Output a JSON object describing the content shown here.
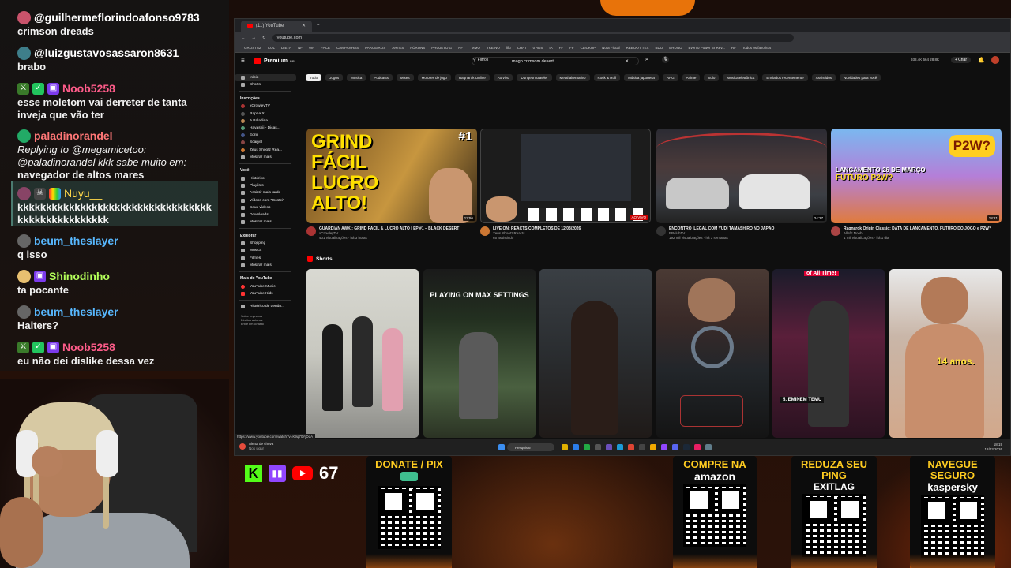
{
  "chat": {
    "messages": [
      {
        "user": "@guilhermeflorindoafonso9783",
        "text": "crimson dreads",
        "color": "#ffffff",
        "avatar_color": "#c9536b",
        "badges": []
      },
      {
        "user": "@luizgustavosassaron8631",
        "text": "brabo",
        "color": "#ffffff",
        "avatar_color": "#3e7e8a",
        "badges": []
      },
      {
        "user": "Noob5258",
        "text": "esse moletom vai derreter de tanta inveja que vão ter",
        "color": "#ff5c8a",
        "avatar_color": "#6c3",
        "badges": [
          "sword-icon",
          "check-icon",
          "sub-icon"
        ]
      },
      {
        "user": "paladinorandel",
        "text": "Replying to @megamicetoo: @paladinorandel kkk sabe muito em:  navegador de altos mares",
        "color": "#ff7777",
        "avatar_color": "#22aa66",
        "badges": []
      },
      {
        "user": "Nuyu__",
        "text": "kkkkkkkkkkkkkkkkkkkkkkkkkkkkkkkkkkkkkkkkkkkkkkkkkk",
        "color": "#ffd84a",
        "avatar_color": "#884466",
        "badges": [
          "skull-icon",
          "rainbow-icon"
        ]
      },
      {
        "user": "beum_theslayer",
        "text": "q isso",
        "color": "#58b8ff",
        "avatar_color": "#666666",
        "badges": []
      },
      {
        "user": "Shinodinho",
        "text": "ta pocante",
        "color": "#b4ff5a",
        "avatar_color": "#e8c070",
        "badges": [
          "sub-icon"
        ]
      },
      {
        "user": "beum_theslayer",
        "text": "Haiters?",
        "color": "#58b8ff",
        "avatar_color": "#666666",
        "badges": []
      },
      {
        "user": "Noob5258",
        "text": "eu não dei dislike dessa vez",
        "color": "#ff5c8a",
        "avatar_color": "#6c3",
        "badges": [
          "sword-icon",
          "check-icon",
          "sub-icon"
        ]
      }
    ],
    "reply_prefix": "Replying to @megamicetoo: @paladinorandel kkk sabe muito em:",
    "reply_rest": "navegador de altos mares"
  },
  "socials": {
    "viewer_count": "67",
    "icons": [
      "kick-icon",
      "twitch-icon",
      "youtube-icon"
    ]
  },
  "qr_panels": [
    {
      "title": "DONATE / PIX",
      "sub": ""
    },
    {
      "title": "COMPRE NA",
      "sub": "amazon"
    },
    {
      "title": "REDUZA SEU PING",
      "sub": "EXITLAG"
    },
    {
      "title": "NAVEGUE SEGURO",
      "sub": "kaspersky"
    }
  ],
  "browser": {
    "tab_title": "(11) YouTube",
    "url": "youtube.com",
    "bookmarks": [
      "GROSTSZ",
      "COL",
      "DIETA",
      "NF",
      "WP",
      "FACE",
      "CAMPANHAS",
      "PARCEIROS",
      "ARTES",
      "FÓRUNS",
      "PROJETO G",
      "NFT",
      "MMO",
      "TREINO",
      "lifu",
      "CHAT",
      "0 ADS",
      "IA",
      "FF",
      "FF",
      "CLICKUP",
      "Nota Fiscal",
      "REBOOT TEX",
      "BDO",
      "BRUNO",
      "Evento Power Br Rev...",
      "RF",
      "Todos os favoritos"
    ],
    "status_url": "https://www.youtube.com/watch?v=K9q70YjDqA"
  },
  "youtube": {
    "logo": "Premium",
    "logo_suffix": "BR",
    "filters": "Filtros",
    "search_text": "mago crimsom desert",
    "create": "+ Criar",
    "header_right": "938.4K   664   28.8K",
    "chips": [
      "Tudo",
      "Jogos",
      "Música",
      "Podcasts",
      "Mixes",
      "Motores de jogo",
      "Ragnarök Online",
      "Ao vivo",
      "Dungeon crawler",
      "Metal alternativo",
      "Rock & Roll",
      "Música japonesa",
      "RPG",
      "Anime",
      "Solo",
      "Música eletrônica",
      "Enviados recentemente",
      "Assistidos",
      "Novidades para você"
    ],
    "sidebar": {
      "main": [
        "Início",
        "Shorts"
      ],
      "subs_header": "Inscrições",
      "subs": [
        "xCrowleyTV",
        "Rapha X",
        "A Paladina",
        "Hayashii - Dicas...",
        "Egrin",
        "Scaryel",
        "Zeus Shootz Rea..."
      ],
      "show_more": "Mostrar mais",
      "you_header": "Você",
      "you": [
        "Histórico",
        "Playlists",
        "Assistir mais tarde",
        "Vídeos com \"Gostei\"",
        "Seus vídeos",
        "Downloads",
        "Mostrar mais"
      ],
      "explore_header": "Explorar",
      "explore": [
        "Shopping",
        "Música",
        "Filmes",
        "Mostrar mais"
      ],
      "more_header": "Mais do YouTube",
      "more": [
        "YouTube Music",
        "YouTube Kids"
      ],
      "footer": [
        "Histórico de denún...",
        "Sobre  Imprensa",
        "Direitos autorais",
        "Entre em contato"
      ]
    },
    "videos": [
      {
        "title": "GUARDIAN AWK : GRIND FÁCIL & LUCRO ALTO | EP #1 – BLACK DESERT",
        "channel": "xCrowleyTV",
        "views": "401 visualizações · há 3 horas",
        "duration": "12:56",
        "thumb_text": "GRIND FÁCIL LUCRO ALTO!",
        "thumb_num": "#1"
      },
      {
        "title": "LIVE ON: REACTS COMPLETOS DE 12/03/2026",
        "channel": "Zeus Shootz Reacts",
        "views": "65 assistindo",
        "duration": "AO VIVO"
      },
      {
        "title": "ENCONTRO ILEGAL COM YUDI TAMASHIRO NO JAPÃO",
        "channel": "BRclubTV",
        "views": "192 mil visualizações · há 3 semanas",
        "duration": "24:27"
      },
      {
        "title": "Ragnarok Origin Classic: DATA DE LANÇAMENTO, FUTURO DO JOGO e P2W?",
        "channel": "AllefF Noob",
        "views": "1 mil visualizações · há 1 dia",
        "duration": "28:21",
        "thumb_badge": "P2W?",
        "thumb_line1": "LANÇAMENTO 26 DE MARÇO",
        "thumb_line2": "FUTURO P2W?"
      }
    ],
    "shorts_title": "Shorts",
    "shorts": [
      {
        "title": "RUDE #지효 #oke #chinesegirl #dance #fyp",
        "views": "63 mil visualizações"
      },
      {
        "title": "When your mate plays on a potato...",
        "views": "21 mi de visualizações",
        "overlay": "PLAYING ON MAX SETTINGS"
      },
      {
        "title": "PRETTIEST in QUEZON CITY | WRONG TURN WALK on COMMONWEALTH #philippines #travel",
        "views": "8,1 mi de visualizações"
      },
      {
        "title": "330B Silver Lost in One Short | BDO Hunting Shorts",
        "views": "44 mil visualizações"
      },
      {
        "title": "Ranking the Funniest Voice Auditions of All Time!",
        "views": "8,3 mi de visualizações",
        "overlay": "of All Time!",
        "overlay2": "5. EMINEM TEMU"
      },
      {
        "title": "Jovem de 14 anos impressionou os jurados! 😱 🏀 #casadoscampeões #atletas #maxitatuim",
        "views": "8,9 mi de visualizações",
        "overlay": "14 anos."
      }
    ]
  },
  "taskbar": {
    "notification_title": "Alerta de chuva",
    "notification_sub": "Nos sigur",
    "search_placeholder": "Pesquisar",
    "time": "18:19",
    "date": "12/03/2026"
  }
}
